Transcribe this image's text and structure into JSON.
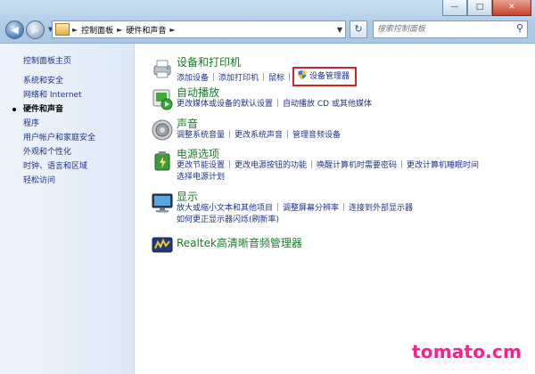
{
  "window": {
    "buttons": {
      "minimize": "—",
      "maximize": "□",
      "close": "✕"
    }
  },
  "nav": {
    "breadcrumb": [
      "控制面板",
      "硬件和声音"
    ],
    "search_placeholder": "搜索控制面板"
  },
  "sidebar": {
    "home": "控制面板主页",
    "items": [
      {
        "label": "系统和安全"
      },
      {
        "label": "网络和 Internet"
      },
      {
        "label": "硬件和声音",
        "active": true
      },
      {
        "label": "程序"
      },
      {
        "label": "用户帐户和家庭安全"
      },
      {
        "label": "外观和个性化"
      },
      {
        "label": "时钟、语言和区域"
      },
      {
        "label": "轻松访问"
      }
    ]
  },
  "categories": {
    "devices": {
      "title": "设备和打印机",
      "links": [
        "添加设备",
        "添加打印机",
        "鼠标",
        "设备管理器"
      ]
    },
    "autoplay": {
      "title": "自动播放",
      "links": [
        "更改媒体或设备的默认设置",
        "自动播放 CD 或其他媒体"
      ]
    },
    "sound": {
      "title": "声音",
      "links": [
        "调整系统音量",
        "更改系统声音",
        "管理音频设备"
      ]
    },
    "power": {
      "title": "电源选项",
      "links": [
        "更改节能设置",
        "更改电源按钮的功能",
        "唤醒计算机时需要密码",
        "更改计算机睡眠时间",
        "选择电源计划"
      ]
    },
    "display": {
      "title": "显示",
      "links": [
        "放大或缩小文本和其他项目",
        "调整屏幕分辨率",
        "连接到外部显示器",
        "如何更正显示器闪烁(刷新率)"
      ]
    },
    "realtek": {
      "title": "Realtek高清晰音频管理器"
    }
  },
  "watermark": "tomato.cm",
  "colors": {
    "link": "#1e3287",
    "category_title": "#1b7a2a",
    "highlight_box": "#d8221f",
    "watermark": "#ff1e8c"
  }
}
